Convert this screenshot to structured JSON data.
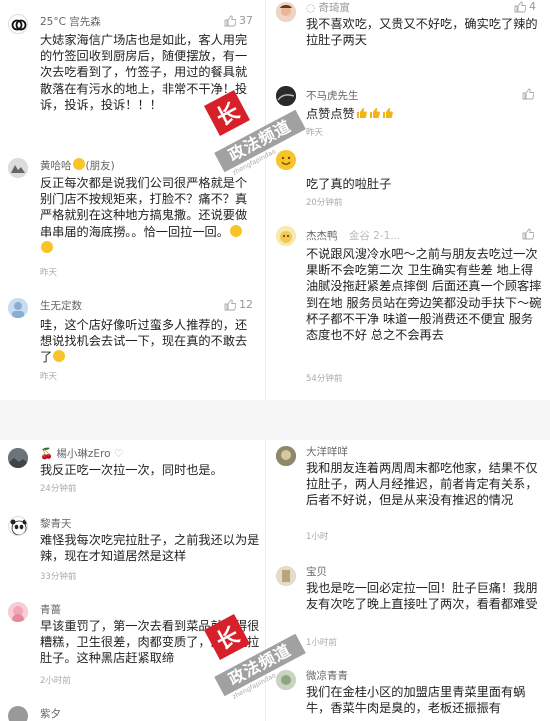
{
  "watermark": {
    "text": "政法频道",
    "sub": "zhengfapindao"
  },
  "panel1": {
    "comments": [
      {
        "name": "25°C 宫先森",
        "likes": "37",
        "text": "大娡家海信广场店也是如此，客人用完的竹签回收到厨房后，随便摆放，有一次去吃看到了，竹签子，用过的餐具就散落在有污水的地上，非常不干净！投诉，投诉，投诉！！！",
        "time": ""
      },
      {
        "name": "黄哈哈",
        "name_suffix": "(朋友)",
        "likes": "",
        "text": "反正每次都是说我们公司很严格就是个别门店不按规矩来，打脸不？痛不？真严格就别在这种地方搞鬼撒。还说要做串串届的海底撈。。恰一回拉一回。",
        "time": "昨天"
      },
      {
        "name": "生无定数",
        "likes": "12",
        "text": "哇，这个店好像听过蛮多人推荐的，还想说找机会去试一下，现在真的不敢去了",
        "time": "昨天"
      }
    ]
  },
  "panel2": {
    "comments": [
      {
        "name": "",
        "likes": "4",
        "text": "我不喜欢吃，又贵又不好吃，确实吃了辣的拉肚子两天",
        "time": ""
      },
      {
        "name": "不马虎先生",
        "likes": "",
        "text": "点赞点赞",
        "time": "昨天"
      },
      {
        "name": "",
        "likes": "",
        "text": "吃了真的啦肚子",
        "time": "20分钟前"
      },
      {
        "name": "杰杰鸭",
        "name_suffix": "金谷 2-1...",
        "likes": "",
        "text": "不说跟风溲冷水吧～之前与朋友去吃过一次果断不会吃第二次 卫生确实有些差 地上得油腻没拖赶紧差点摔倒 后面还真一个顾客摔到在地 服务员站在旁边笑都没动手扶下～碗杯子都不干净 味道一般消费还不便宜 服务态度也不好 总之不会再去",
        "time": "54分钟前"
      }
    ]
  },
  "panel3": {
    "comments": [
      {
        "name": "楊小琳zEro",
        "likes": "",
        "text": "我反正吃一次拉一次，同时也是。",
        "time": "24分钟前"
      },
      {
        "name": "黎青天",
        "likes": "",
        "text": "难怪我每次吃完拉肚子，之前我还以为是辣，现在才知道居然是这样",
        "time": "33分钟前"
      },
      {
        "name": "青蔷",
        "likes": "",
        "text": "早该重罚了，第一次去看到菜品就觉得很糟糕，卫生很差，肉都变质了，回去就拉肚子。这种黑店赶紧取缔",
        "time": "2小时前"
      },
      {
        "name": "紫夕",
        "likes": "",
        "text": "",
        "time": ""
      }
    ]
  },
  "panel4": {
    "comments": [
      {
        "name": "大洋咩咩",
        "likes": "",
        "text": "我和朋友连着两周周末都吃他家，结果不仅拉肚子，两人月经推迟，前者肯定有关系，后者不好说，但是从来没有推迟的情况",
        "time": "1小时"
      },
      {
        "name": "宝贝",
        "likes": "",
        "text": "我也是吃一回必定拉一回！肚子巨痛！我朋友有次吃了晚上直接吐了两次，看看都难受",
        "time": "1小时前"
      },
      {
        "name": "微凉青青",
        "likes": "",
        "text": "我们在金桂小区的加盟店里青菜里面有蜗牛，香菜牛肉是臭的，老板还振振有",
        "time": ""
      }
    ]
  }
}
